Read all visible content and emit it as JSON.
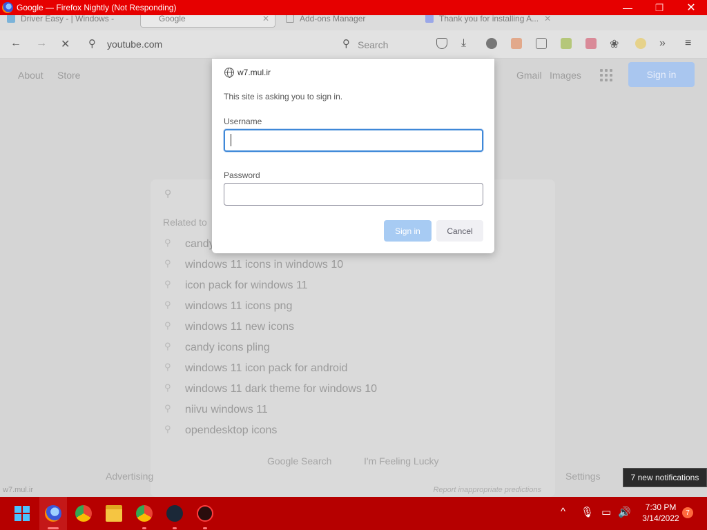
{
  "window": {
    "title": "Google — Firefox Nightly (Not Responding)",
    "min_glyph": "—",
    "max_glyph": "❐",
    "close_glyph": "✕"
  },
  "tabs": [
    {
      "label": "Driver Easy - | Windows -",
      "active": false
    },
    {
      "label": "Google",
      "active": true
    },
    {
      "label": "Add-ons Manager",
      "active": false
    },
    {
      "label": "Thank you for installing A...",
      "active": false
    }
  ],
  "navbar": {
    "url": "youtube.com",
    "search_placeholder": "Search"
  },
  "page": {
    "top_links": [
      "About",
      "Store"
    ],
    "right_links": [
      "Gmail",
      "Images"
    ],
    "signin_label": "Sign in",
    "related_label": "Related to",
    "suggestions": [
      "candy",
      "windows 11 icons in windows 10",
      "icon pack for windows 11",
      "windows 11 icons png",
      "windows 11 new icons",
      "candy icons pling",
      "windows 11 icon pack for android",
      "windows 11 dark theme for windows 10",
      "niivu windows 11",
      "opendesktop icons"
    ],
    "google_search_label": "Google Search",
    "lucky_label": "I'm Feeling Lucky",
    "report_label": "Report inappropriate predictions",
    "footer_left": "Advertising",
    "footer_right": "Settings",
    "status_url": "w7.mul.ir"
  },
  "auth_dialog": {
    "host": "w7.mul.ir",
    "message": "This site is asking you to sign in.",
    "username_label": "Username",
    "username_value": "",
    "password_label": "Password",
    "password_value": "",
    "signin_button": "Sign in",
    "cancel_button": "Cancel"
  },
  "notification_tooltip": "7 new notifications",
  "taskbar": {
    "time": "7:30 PM",
    "date": "3/14/2022",
    "badge_count": "7",
    "apps": [
      "start-icon",
      "firefox-nightly-icon",
      "chrome-icon",
      "file-explorer-icon",
      "chrome-icon",
      "steam-icon",
      "app-icon"
    ]
  },
  "colors": {
    "titlebar": "#e60000",
    "taskbar": "#b60000",
    "accent": "#3e88d8"
  }
}
